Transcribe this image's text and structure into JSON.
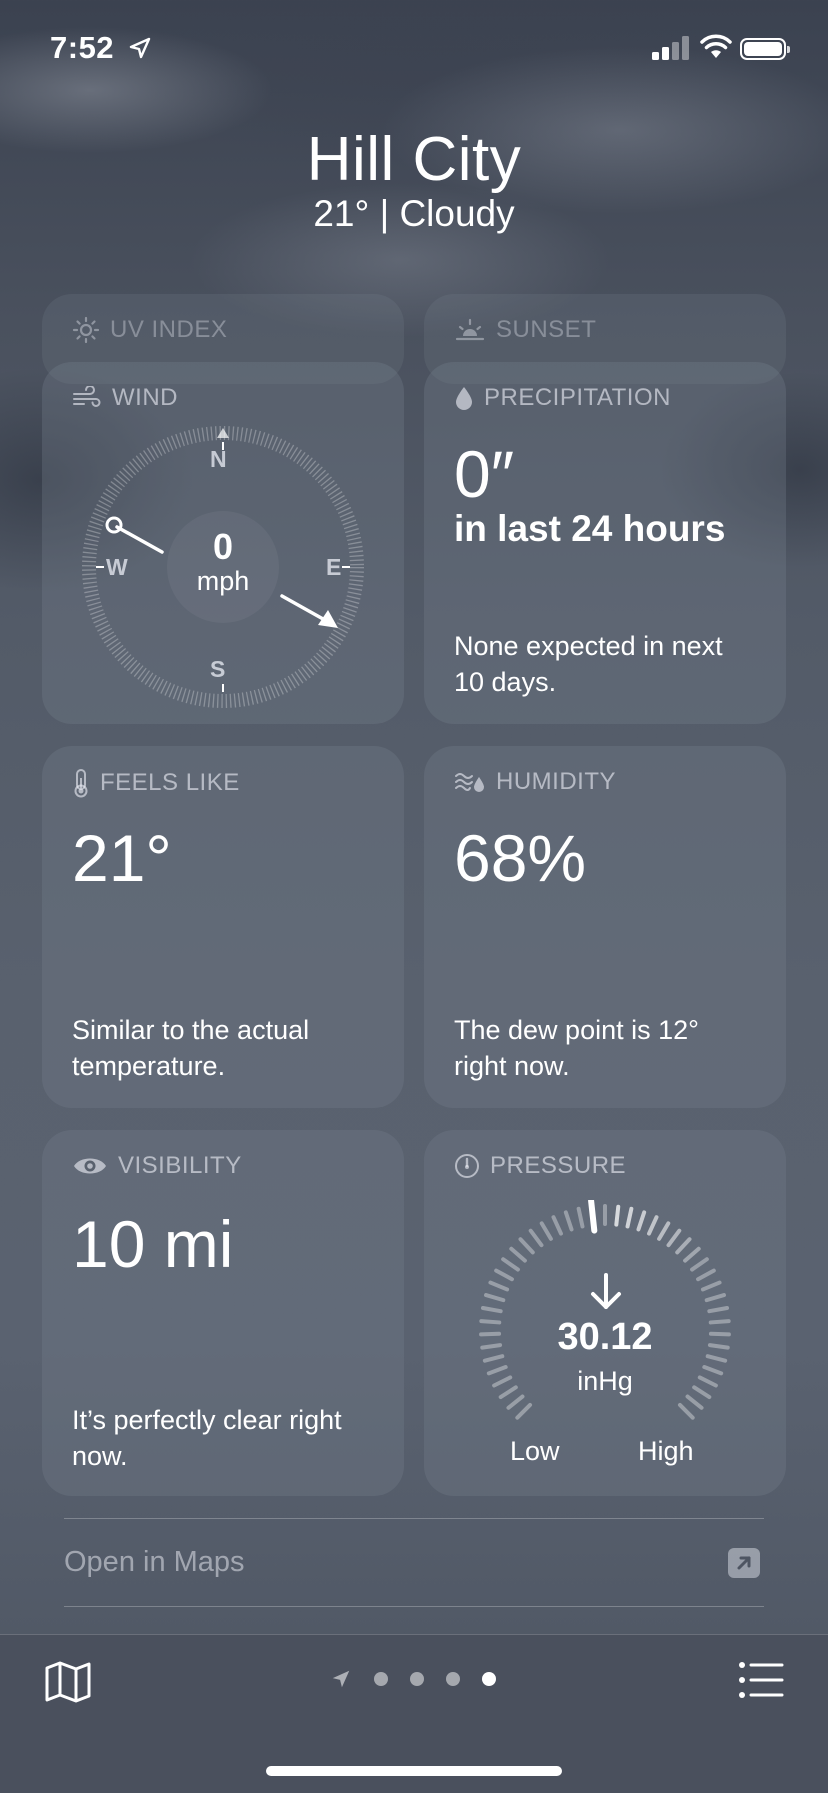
{
  "status_bar": {
    "time": "7:52"
  },
  "header": {
    "city": "Hill City",
    "condition": "21°  |  Cloudy"
  },
  "cards": {
    "uv": {
      "title": "UV INDEX"
    },
    "sunset": {
      "title": "SUNSET"
    },
    "wind": {
      "title": "WIND",
      "speed": "0",
      "unit": "mph",
      "n": "N",
      "e": "E",
      "s": "S",
      "w": "W"
    },
    "precipitation": {
      "title": "PRECIPITATION",
      "value": "0″",
      "period": "in last 24 hours",
      "note": "None expected in next 10 days."
    },
    "feels_like": {
      "title": "FEELS LIKE",
      "value": "21°",
      "note": "Similar to the actual temperature."
    },
    "humidity": {
      "title": "HUMIDITY",
      "value": "68%",
      "note": "The dew point is 12° right now."
    },
    "visibility": {
      "title": "VISIBILITY",
      "value": "10 mi",
      "note": "It’s perfectly clear right now."
    },
    "pressure": {
      "title": "PRESSURE",
      "value": "30.12",
      "unit": "inHg",
      "low": "Low",
      "high": "High"
    }
  },
  "maps": {
    "label": "Open in Maps"
  },
  "icons": [
    "location-arrow-icon",
    "signal-icon",
    "wifi-icon",
    "battery-icon",
    "sun-icon",
    "sunset-icon",
    "wind-icon",
    "drop-icon",
    "thermometer-icon",
    "humidity-icon",
    "eye-icon",
    "gauge-icon",
    "map-icon",
    "list-icon",
    "external-link-icon"
  ]
}
